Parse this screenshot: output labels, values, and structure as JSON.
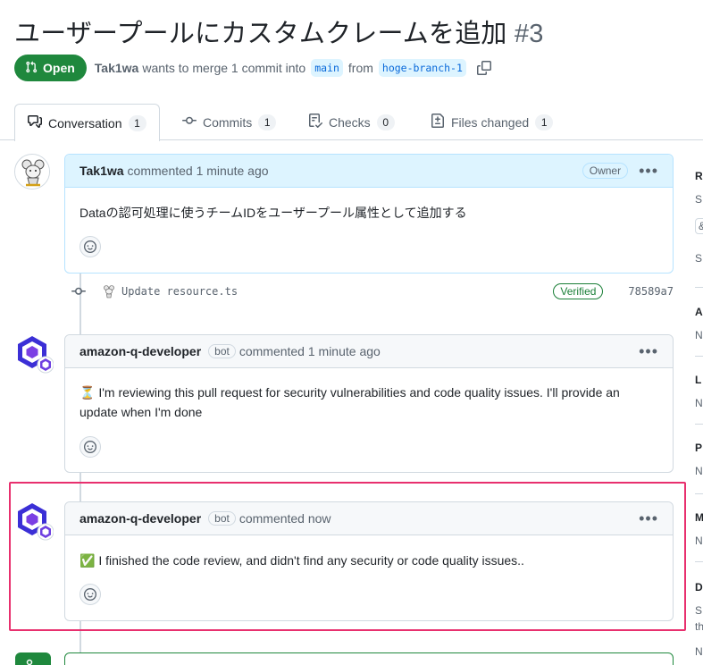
{
  "pr": {
    "title": "ユーザープールにカスタムクレームを追加",
    "number": "#3",
    "state": "Open",
    "author": "Tak1wa",
    "merge_text": "wants to merge 1 commit into",
    "base_branch": "main",
    "from_text": "from",
    "head_branch": "hoge-branch-1"
  },
  "tabs": [
    {
      "label": "Conversation",
      "count": "1"
    },
    {
      "label": "Commits",
      "count": "1"
    },
    {
      "label": "Checks",
      "count": "0"
    },
    {
      "label": "Files changed",
      "count": "1"
    }
  ],
  "comments": [
    {
      "author": "Tak1wa",
      "action": "commented 1 minute ago",
      "badge": "Owner",
      "body": "Dataの認可処理に使うチームIDをユーザープール属性として追加する"
    },
    {
      "author": "amazon-q-developer",
      "bot_label": "bot",
      "action": "commented 1 minute ago",
      "emoji": "⏳",
      "body": "I'm reviewing this pull request for security vulnerabilities and code quality issues. I'll provide an update when I'm done"
    },
    {
      "author": "amazon-q-developer",
      "bot_label": "bot",
      "action": "commented now",
      "emoji": "✅",
      "body": "I finished the code review, and didn't find any security or code quality issues.."
    }
  ],
  "commit": {
    "message": "Update resource.ts",
    "verified": "Verified",
    "sha": "78589a7"
  },
  "sidebar_fragments": {
    "r1": "R",
    "r2": "S",
    "r3": "&",
    "r4": "S",
    "a1": "A",
    "a2": "N",
    "l1": "L",
    "l2": "N",
    "p1": "P",
    "p2": "N",
    "m1": "M",
    "m2": "N",
    "d1": "D",
    "d2": "S",
    "d3": "th",
    "d4": "N"
  },
  "colors": {
    "accent_green": "#1f883d",
    "link_blue": "#0969da",
    "highlight_pink": "#e8306e"
  }
}
